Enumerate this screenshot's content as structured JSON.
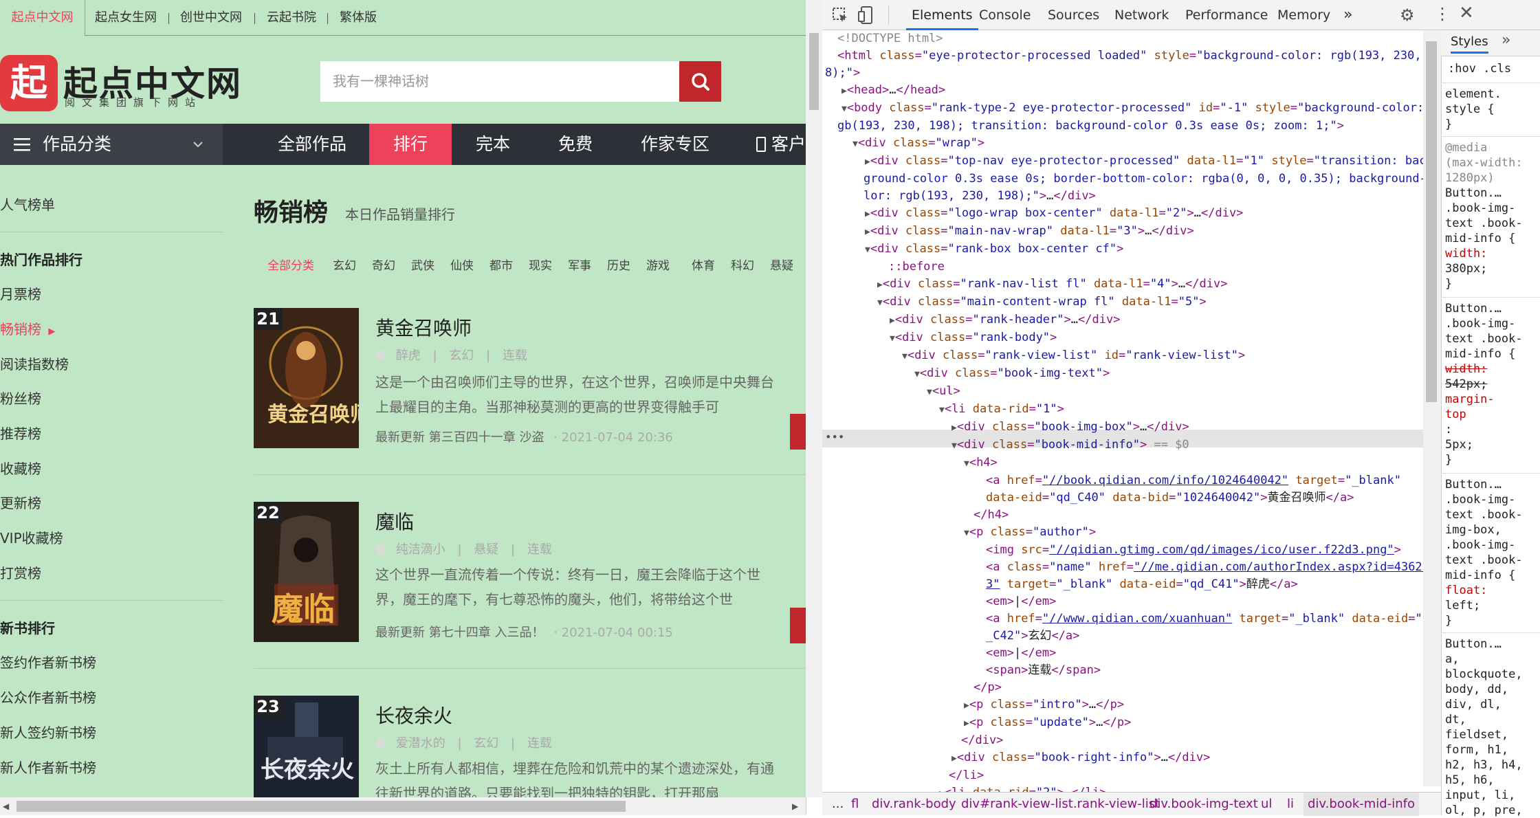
{
  "topnav": {
    "items": [
      "起点中文网",
      "起点女生网",
      "创世中文网",
      "云起书院",
      "繁体版"
    ]
  },
  "logo": {
    "badge": "起",
    "name": "起点中文网",
    "tagline": "阅文集团旗下网站"
  },
  "search": {
    "placeholder": "我有一棵神话树"
  },
  "mainnav": {
    "category": "作品分类",
    "items": [
      "全部作品",
      "排行",
      "完本",
      "免费",
      "作家专区",
      "客户"
    ]
  },
  "sidebar": {
    "items": [
      {
        "label": "人气榜单",
        "type": "header-plain"
      },
      {
        "label": "热门作品排行",
        "type": "header"
      },
      {
        "label": "月票榜"
      },
      {
        "label": "畅销榜",
        "active": true
      },
      {
        "label": "阅读指数榜"
      },
      {
        "label": "粉丝榜"
      },
      {
        "label": "推荐榜"
      },
      {
        "label": "收藏榜"
      },
      {
        "label": "更新榜"
      },
      {
        "label": "VIP收藏榜"
      },
      {
        "label": "打赏榜"
      },
      {
        "label": "新书排行",
        "type": "header"
      },
      {
        "label": "签约作者新书榜"
      },
      {
        "label": "公众作者新书榜"
      },
      {
        "label": "新人签约新书榜"
      },
      {
        "label": "新人作者新书榜"
      }
    ]
  },
  "rank": {
    "title": "畅销榜",
    "subtitle": "本日作品销量排行",
    "filters": [
      "全部分类",
      "玄幻",
      "奇幻",
      "武侠",
      "仙侠",
      "都市",
      "现实",
      "军事",
      "历史",
      "游戏",
      "体育",
      "科幻",
      "悬疑"
    ],
    "books": [
      {
        "rank": "21",
        "name": "黄金召唤师",
        "author": "醉虎",
        "genre": "玄幻",
        "status": "连载",
        "intro": "这是一个由召唤师们主导的世界，在这个世界，召唤师是中央舞台上最耀目的主角。当那神秘莫测的更高的世界变得触手可",
        "update_label": "最新更新",
        "update_chapter": "第三百四十一章 沙盗",
        "update_time": "2021-07-04 20:36",
        "cover_title": "黄金召唤师",
        "cover_color": "#3a2416"
      },
      {
        "rank": "22",
        "name": "魔临",
        "author": "纯洁滴小",
        "genre": "悬疑",
        "status": "连载",
        "intro": "这个世界一直流传着一个传说：终有一日，魔王会降临于这个世界，魔王的麾下，有七尊恐怖的魔头，他们，将带给这个世",
        "update_label": "最新更新",
        "update_chapter": "第七十四章 入三品！",
        "update_time": "2021-07-04 00:15",
        "cover_title": "魔临",
        "cover_color": "#2a1e18"
      },
      {
        "rank": "23",
        "name": "长夜余火",
        "author": "爱潜水的",
        "genre": "玄幻",
        "status": "连载",
        "intro": "灰土上所有人都相信，埋葬在危险和饥荒中的某个遗迹深处，有通往新世界的道路。只要能找到一把独特的钥匙，打开那扇",
        "update_label": "",
        "update_chapter": "",
        "update_time": "",
        "cover_title": "长夜余火",
        "cover_color": "#1c2230"
      }
    ]
  },
  "devtools": {
    "tabs": [
      "Elements",
      "Console",
      "Sources",
      "Network",
      "Performance",
      "Memory"
    ],
    "more": "»",
    "breadcrumb": [
      "...",
      "fl",
      "div.rank-body",
      "div#rank-view-list.rank-view-list",
      "div.book-img-text",
      "ul",
      "li",
      "div.book-mid-info"
    ],
    "styles_tab": "Styles",
    "styles_more": "»",
    "styles_filters": ":hov .cls",
    "styles": [
      "element.",
      "style {",
      "}",
      "@media",
      "(max-width:",
      "1280px)",
      " Button.…",
      ".book-img-",
      "text .book-",
      "mid-info {",
      "  width:",
      "   380px;",
      "}"
    ],
    "styles2": [
      " Button.…",
      ".book-img-",
      "text .book-",
      "mid-info {",
      "  width:",
      "   542px;",
      "  margin-",
      "   top",
      "   :",
      "   5px;",
      "}"
    ],
    "styles3": [
      " Button.…",
      ".book-img-",
      "text .book-",
      "img-box,",
      ".book-img-",
      "text .book-",
      "mid-info {",
      "  float:",
      "   left;",
      "}"
    ],
    "styles4": [
      " Button.…",
      "a,",
      "blockquote,",
      "body, dd,",
      "div, dl,",
      "dt,",
      "fieldset,",
      "form, h1,",
      "h2, h3, h4,",
      "h5, h6,",
      "input, li,",
      "ol, p, pre,"
    ]
  }
}
